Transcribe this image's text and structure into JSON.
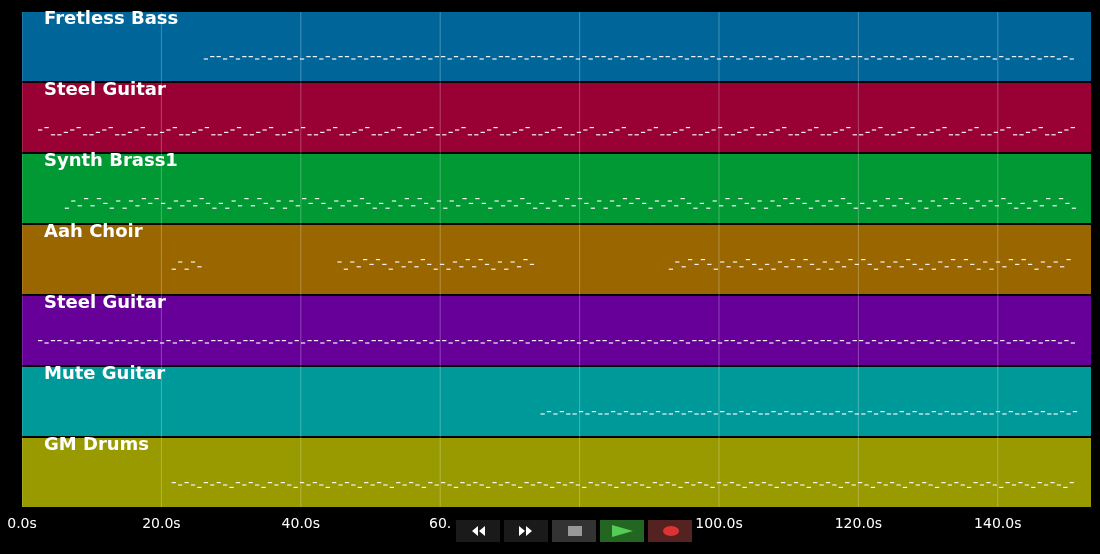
{
  "tracks": [
    {
      "name": "Fretless Bass",
      "color": "#00669a"
    },
    {
      "name": "Steel Guitar",
      "color": "#990033"
    },
    {
      "name": "Synth Brass1",
      "color": "#009933"
    },
    {
      "name": "Aah Choir",
      "color": "#996600"
    },
    {
      "name": "Steel Guitar",
      "color": "#660099"
    },
    {
      "name": "Mute Guitar",
      "color": "#009999"
    },
    {
      "name": "GM Drums",
      "color": "#999900"
    }
  ],
  "axis": {
    "ticks": [
      "0.0s",
      "20.0s",
      "40.0s",
      "60.",
      "100.0s",
      "120.0s",
      "140.0s"
    ]
  },
  "transport": [
    {
      "kind": "rewind"
    },
    {
      "kind": "forward"
    },
    {
      "kind": "stop"
    },
    {
      "kind": "play"
    },
    {
      "kind": "record"
    }
  ]
}
